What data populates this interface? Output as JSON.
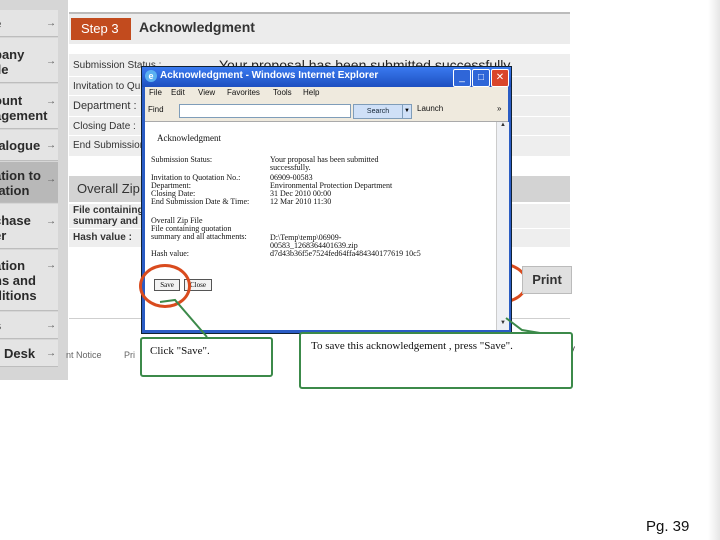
{
  "sidebar": {
    "items": [
      {
        "label": "e"
      },
      {
        "label": "pany",
        "label2": "ile"
      },
      {
        "label": "ount",
        "label2": "agement"
      },
      {
        "label": "talogue"
      },
      {
        "label": "ation to",
        "label2": "tation"
      },
      {
        "label": "chase",
        "label2": "er"
      },
      {
        "label": "ation",
        "label2": "ns and",
        "label3": "ditions"
      },
      {
        "label": "s"
      },
      {
        "label": "Desk"
      }
    ]
  },
  "header": {
    "step": "Step 3",
    "title": "Acknowledgment"
  },
  "form": {
    "submission_status": "Submission Status :",
    "invitation": "Invitation to Qu",
    "department": "Department :",
    "closing_date": "Closing Date :",
    "end_submission": "End Submission",
    "status_message": "Your proposal has been submitted successfully.",
    "zip_title": "Overall Zip",
    "file_containing": "File containing",
    "summary_and": "summary and c",
    "hash_value": "Hash value :"
  },
  "actions": {
    "save_peek": "e",
    "print": "Print"
  },
  "footer": {
    "notice": "nt Notice",
    "pr": "Pri",
    "y": "y"
  },
  "ie": {
    "title": "Acknowledgment - Windows Internet Explorer",
    "menu": [
      "File",
      "Edit",
      "View",
      "Favorites",
      "Tools",
      "Help"
    ],
    "find_label": "Find",
    "search_label": "Search",
    "launch_label": "Launch",
    "doc": {
      "heading": "Acknowledgment",
      "rows": [
        {
          "label": "Submission Status:",
          "value": "Your proposal has been submitted successfully."
        },
        {
          "label": "Invitation to Quotation No.:",
          "value": "06909-00583"
        },
        {
          "label": "Department:",
          "value": "Environmental Protection Department"
        },
        {
          "label": "Closing Date:",
          "value": "31 Dec 2010 00:00"
        },
        {
          "label": "End Submission Date & Time:",
          "value": "12 Mar 2010 11:30"
        }
      ],
      "zip_heading": "Overall Zip File",
      "file_label": "File containing quotation summary and all attachments:",
      "file_value": "D:\\Temp\\temp\\06909-00583_1268364401639.zip",
      "hash_label": "Hash value:",
      "hash_value": "d7d43b36f5e7524fed64ffa484340177619 10c5",
      "save_button": "Save",
      "close_button": "Close"
    }
  },
  "callouts": {
    "left": "Click \"Save\".",
    "right": "To save this acknowledgement , press \"Save\"."
  },
  "page_number": "Pg. 39",
  "colors": {
    "step_badge": "#c24b1e",
    "highlight_circle": "#d94b1e",
    "callout_border": "#3c8a4a",
    "ie_titlebar": "#1d4fc0"
  }
}
